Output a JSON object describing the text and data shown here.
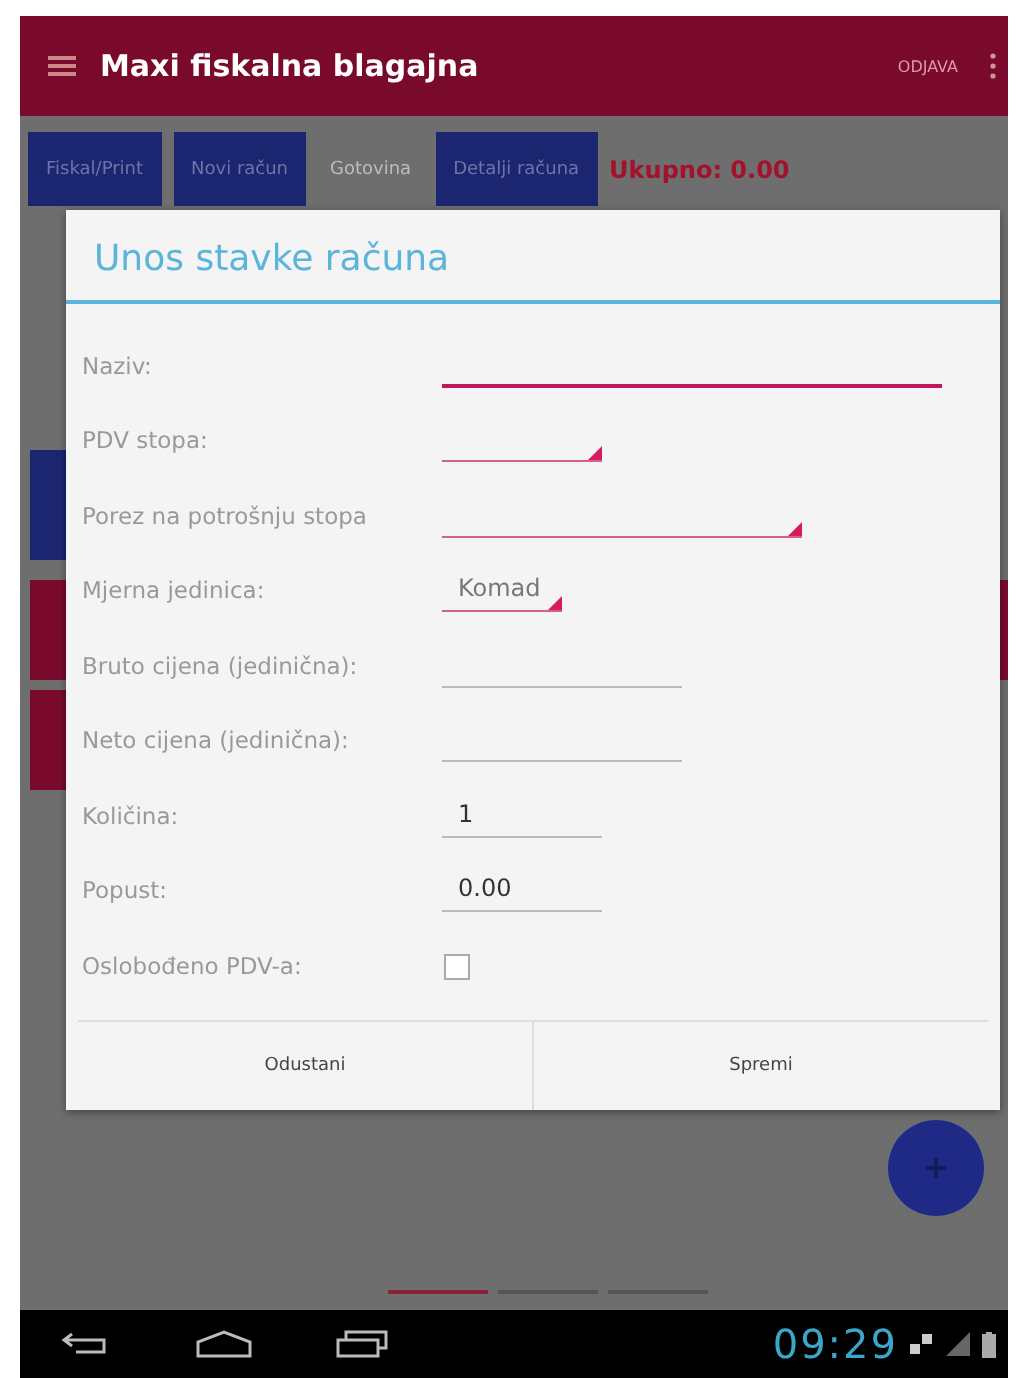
{
  "app_bar": {
    "title": "Maxi fiskalna blagajna",
    "action": "ODJAVA"
  },
  "toolbar": [
    {
      "kind": "button",
      "label": "Fiskal/Print"
    },
    {
      "kind": "button",
      "label": "Novi račun"
    },
    {
      "kind": "spinner",
      "label": "Gotovina"
    },
    {
      "kind": "button",
      "label": "Detalji računa"
    },
    {
      "kind": "total",
      "label": "Ukupno: 0.00"
    }
  ],
  "dialog": {
    "title": "Unos stavke računa",
    "fields": [
      {
        "kind": "text",
        "label": "Naziv:",
        "focused": true
      },
      {
        "kind": "spinner",
        "label": "PDV stopa:"
      },
      {
        "kind": "spinner",
        "label": "Porez na potrošnju stopa"
      },
      {
        "kind": "spinner",
        "label": "Mjerna jedinica:",
        "value": "Komad"
      },
      {
        "kind": "text",
        "label": "Bruto cijena (jedinična):",
        "focused": false
      },
      {
        "kind": "text",
        "label": "Neto cijena (jedinična):",
        "focused": false
      },
      {
        "kind": "text",
        "label": "Količina:",
        "value": "1",
        "focused": false
      },
      {
        "kind": "text",
        "label": "Popust:",
        "value": "0.00",
        "focused": false
      },
      {
        "kind": "checkbox",
        "label": "Oslobođeno PDV-a:",
        "checked": false
      }
    ],
    "buttons": [
      "Odustani",
      "Spremi"
    ]
  },
  "pager": [
    {
      "selected": true
    },
    {
      "selected": false
    },
    {
      "selected": false
    }
  ],
  "status_bar": {
    "time": "09:29"
  }
}
